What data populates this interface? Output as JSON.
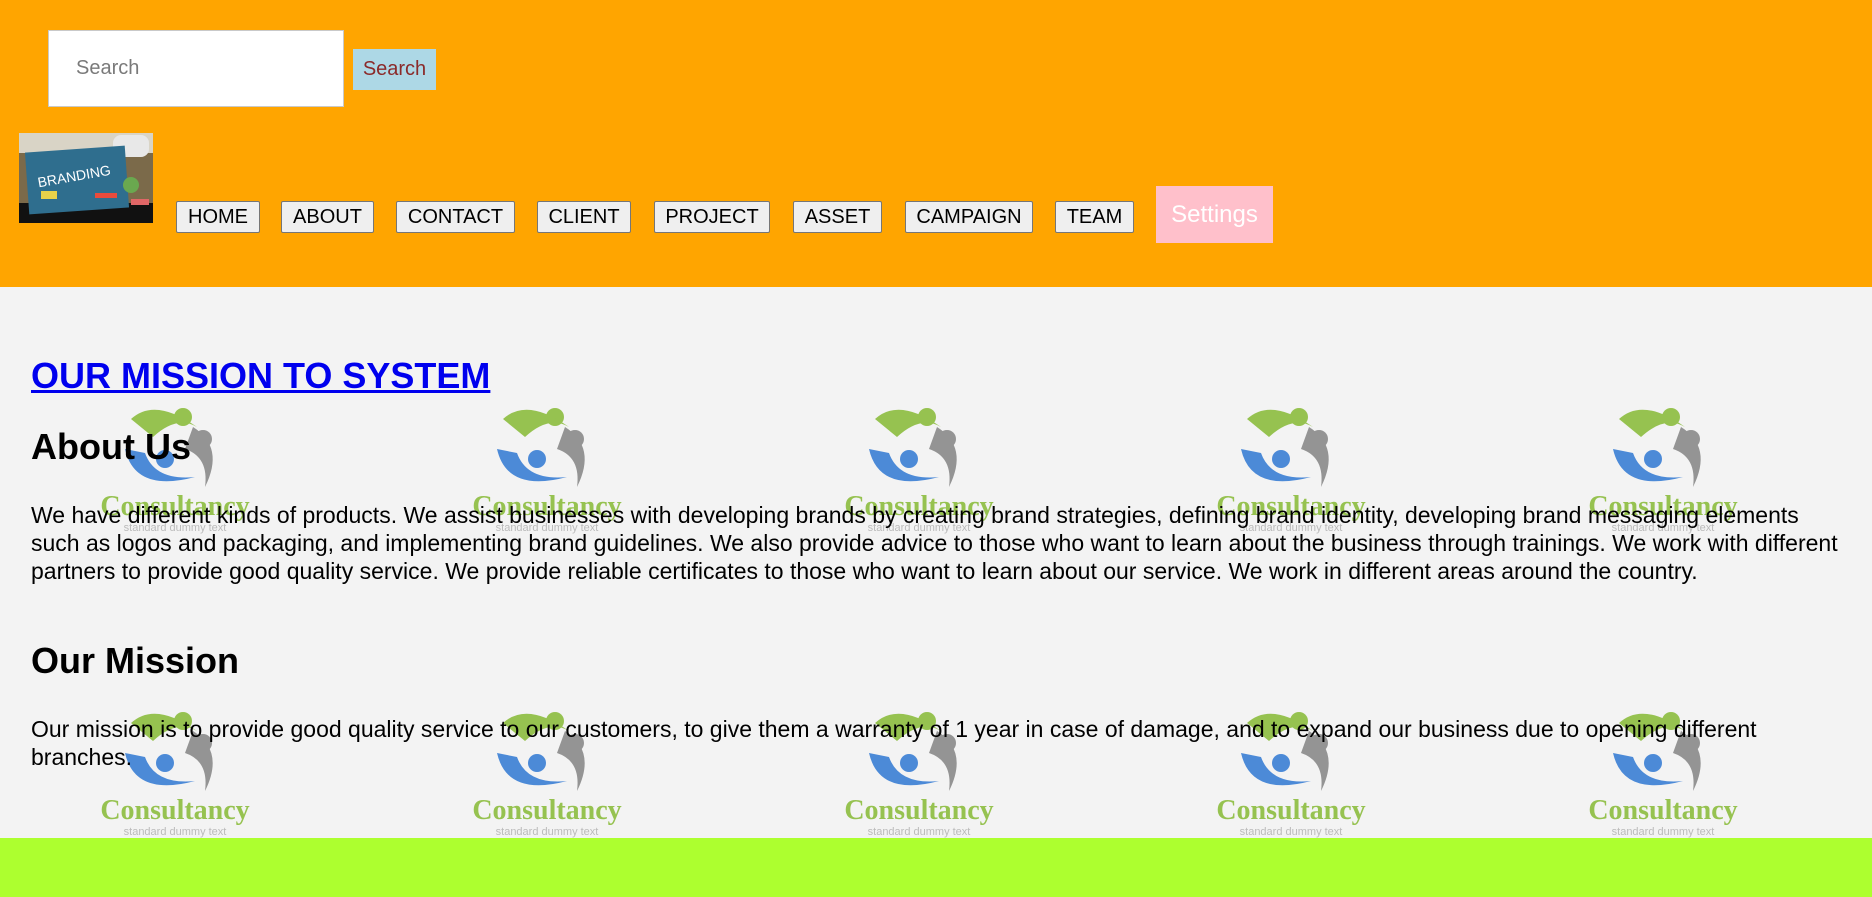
{
  "header": {
    "search": {
      "placeholder": "Search",
      "button_label": "Search"
    },
    "logo": {
      "icon": "branding-logo-image",
      "text": "BRANDING"
    },
    "nav": [
      {
        "label": "HOME"
      },
      {
        "label": "ABOUT"
      },
      {
        "label": "CONTACT"
      },
      {
        "label": "CLIENT"
      },
      {
        "label": "PROJECT"
      },
      {
        "label": "ASSET"
      },
      {
        "label": "CAMPAIGN"
      },
      {
        "label": "TEAM"
      }
    ],
    "settings_label": "Settings"
  },
  "main": {
    "title_link": "OUR MISSION TO SYSTEM",
    "about_heading": "About Us",
    "about_text": "We have different kinds of products. We assist businesses with developing brands by creating brand strategies, defining brand identity, developing brand messaging elements such as logos and packaging, and implementing brand guidelines. We also provide advice to those who want to learn about the business through trainings. We work with different partners to provide good quality service. We provide reliable certificates to those who want to learn about our service. We work in different areas around the country.",
    "mission_heading": "Our Mission",
    "mission_text": "Our mission is to provide good quality service to our customers, to give them a warranty of 1 year in case of damage, and to expand our business due to opening different branches.",
    "watermark": {
      "icon": "consultancy-logo-icon",
      "brand": "Consultancy",
      "tagline": "standard dummy text"
    }
  },
  "colors": {
    "header_bg": "#ffa500",
    "main_bg": "#f3f3f3",
    "footer_bg": "#adff2f",
    "search_button_bg": "#add8e6",
    "search_button_text": "#8b2a2a",
    "settings_bg": "#ffc0cb",
    "link": "#0000ee",
    "watermark_green": "#8cbd3f",
    "watermark_blue": "#3a7fd5",
    "watermark_gray": "#8a8a8a"
  }
}
